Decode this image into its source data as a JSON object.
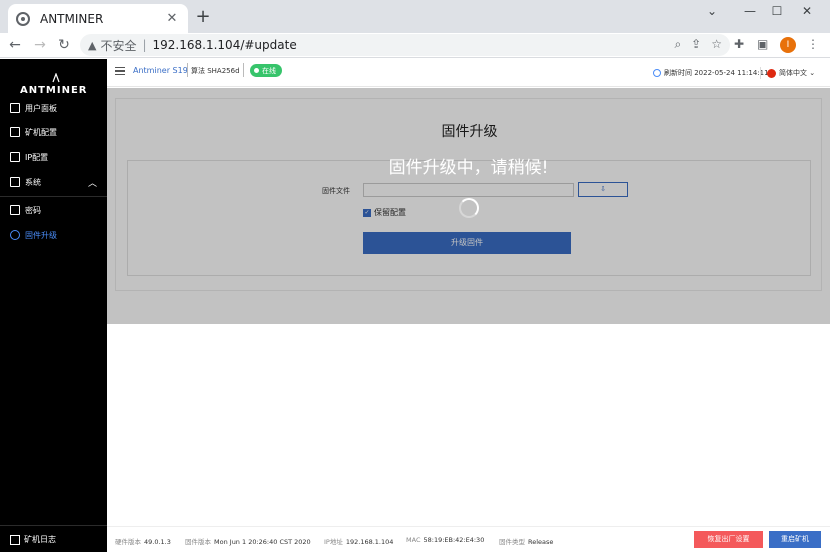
{
  "browser": {
    "tab_title": "ANTMINER",
    "tab_close": "✕",
    "new_tab": "+",
    "minimize": "⌄",
    "min2": "—",
    "maximize": "☐",
    "close": "✕",
    "back": "←",
    "forward": "→",
    "reload": "↻",
    "insecure_label": "不安全",
    "separator": "|",
    "url": "192.168.1.104/#update",
    "profile_initial": "I"
  },
  "sidebar": {
    "brand": "ANTMINER",
    "items": [
      {
        "label": "用户面板"
      },
      {
        "label": "矿机配置"
      },
      {
        "label": "IP配置"
      },
      {
        "label": "系统"
      },
      {
        "label": "密码"
      },
      {
        "label": "固件升级"
      }
    ],
    "system_chevron": "︿",
    "log_label": "矿机日志"
  },
  "header": {
    "model": "Antminer S19",
    "algo_label": "算法 SHA256d",
    "status": "在线",
    "refresh_label": "刷新时间 2022-05-24 11:14:11",
    "language": "简体中文 ⌄"
  },
  "main": {
    "card_title": "固件升级",
    "file_label": "固件文件",
    "upload_icon": "⇩",
    "keep_settings": "保留配置",
    "upgrade_button": "升级固件",
    "overlay_message": "固件升级中，请稍候!"
  },
  "footer": {
    "hw_label": "硬件版本",
    "hw_value": "49.0.1.3",
    "fw_label": "固件版本",
    "fw_value": "Mon Jun 1 20:26:40 CST 2020",
    "ip_label": "IP地址",
    "ip_value": "192.168.1.104",
    "mac_label": "MAC",
    "mac_value": "58:19:EB:42:E4:30",
    "type_label": "固件类型",
    "type_value": "Release",
    "reset_button": "恢复出厂设置",
    "reboot_button": "重启矿机"
  },
  "colors": {
    "accent": "#3a6ec6",
    "online": "#37c46b",
    "danger": "#f4595b",
    "sidebar_bg": "#000000",
    "active_item": "#4a8cf7"
  }
}
